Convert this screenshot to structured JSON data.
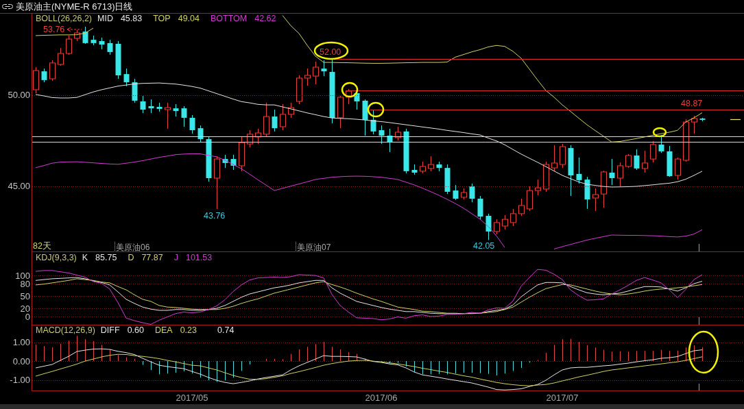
{
  "window": {
    "title": "美原油主(NYME-R 6713)日线"
  },
  "price_panel": {
    "chart_data": {
      "type": "candlestick",
      "ylim": [
        41.39,
        54.51
      ],
      "ohlc": [
        [
          50.3,
          51.54,
          50.11,
          51.35
        ],
        [
          51.31,
          51.46,
          50.71,
          50.83
        ],
        [
          50.9,
          51.92,
          50.79,
          51.77
        ],
        [
          51.69,
          52.59,
          51.62,
          52.29
        ],
        [
          52.29,
          53.27,
          52.22,
          53.08
        ],
        [
          53.12,
          53.57,
          52.97,
          53.42
        ],
        [
          53.49,
          53.76,
          52.82,
          52.86
        ],
        [
          53.04,
          53.27,
          52.74,
          52.86
        ],
        [
          52.97,
          53.16,
          52.52,
          52.78
        ],
        [
          52.86,
          53.04,
          52.22,
          52.37
        ],
        [
          52.82,
          52.97,
          50.9,
          51.09
        ],
        [
          51.16,
          51.46,
          50.49,
          50.71
        ],
        [
          50.71,
          50.9,
          49.59,
          49.7
        ],
        [
          49.66,
          49.96,
          49.02,
          49.21
        ],
        [
          49.4,
          49.77,
          49.02,
          49.28
        ],
        [
          49.36,
          49.59,
          49.1,
          49.25
        ],
        [
          49.21,
          49.59,
          48.16,
          49.32
        ],
        [
          49.28,
          49.51,
          48.83,
          49.13
        ],
        [
          49.28,
          49.4,
          48.27,
          48.76
        ],
        [
          48.76,
          48.91,
          47.89,
          48.08
        ],
        [
          48.19,
          48.34,
          47.4,
          47.59
        ],
        [
          47.59,
          47.71,
          45.26,
          45.45
        ],
        [
          45.45,
          46.65,
          43.76,
          46.5
        ],
        [
          46.5,
          46.73,
          46.01,
          46.28
        ],
        [
          46.5,
          46.73,
          45.9,
          46.13
        ],
        [
          46.13,
          47.71,
          45.83,
          47.4
        ],
        [
          47.33,
          48.08,
          47.14,
          47.86
        ],
        [
          47.71,
          48.16,
          47.33,
          47.93
        ],
        [
          47.86,
          49.59,
          47.71,
          48.83
        ],
        [
          48.83,
          49.21,
          48.01,
          48.19
        ],
        [
          48.27,
          49.51,
          48.08,
          48.95
        ],
        [
          48.95,
          49.59,
          48.76,
          49.32
        ],
        [
          49.66,
          51.09,
          49.51,
          50.94
        ],
        [
          50.94,
          51.46,
          50.52,
          51.09
        ],
        [
          51.05,
          51.84,
          50.6,
          51.54
        ],
        [
          51.46,
          51.92,
          51.05,
          51.31
        ],
        [
          51.28,
          52.0,
          48.46,
          48.76
        ],
        [
          48.76,
          49.96,
          48.19,
          49.89
        ],
        [
          49.89,
          50.34,
          49.51,
          50.22
        ],
        [
          50.11,
          50.22,
          49.21,
          49.66
        ],
        [
          49.7,
          49.77,
          47.78,
          48.65
        ],
        [
          48.65,
          49.21,
          47.86,
          48.01
        ],
        [
          48.08,
          48.34,
          47.33,
          47.78
        ],
        [
          47.78,
          48.16,
          46.88,
          47.44
        ],
        [
          47.67,
          48.27,
          47.52,
          47.97
        ],
        [
          48.01,
          48.16,
          45.71,
          45.83
        ],
        [
          45.9,
          46.2,
          45.64,
          45.75
        ],
        [
          45.83,
          46.35,
          45.71,
          46.09
        ],
        [
          45.98,
          46.65,
          45.83,
          46.2
        ],
        [
          46.2,
          46.35,
          45.83,
          46.01
        ],
        [
          46.01,
          46.2,
          44.58,
          44.7
        ],
        [
          44.77,
          45.07,
          44.25,
          44.32
        ],
        [
          44.4,
          44.89,
          44.28,
          44.66
        ],
        [
          45.0,
          45.15,
          44.13,
          44.32
        ],
        [
          44.32,
          44.47,
          43.19,
          43.34
        ],
        [
          43.38,
          43.5,
          42.05,
          42.52
        ],
        [
          42.52,
          43.19,
          42.37,
          43.01
        ],
        [
          42.82,
          43.42,
          42.63,
          43.19
        ],
        [
          43.01,
          43.76,
          42.82,
          43.5
        ],
        [
          43.5,
          44.32,
          43.38,
          43.95
        ],
        [
          43.76,
          45.0,
          43.65,
          44.77
        ],
        [
          44.77,
          45.37,
          44.51,
          44.92
        ],
        [
          44.85,
          46.35,
          44.7,
          46.2
        ],
        [
          46.01,
          47.25,
          45.83,
          46.28
        ],
        [
          46.2,
          47.33,
          46.01,
          47.18
        ],
        [
          47.1,
          47.25,
          44.47,
          45.6
        ],
        [
          45.68,
          46.58,
          45.15,
          45.34
        ],
        [
          45.37,
          45.52,
          43.76,
          44.28
        ],
        [
          44.36,
          44.89,
          43.65,
          44.55
        ],
        [
          44.58,
          45.86,
          43.83,
          45.79
        ],
        [
          45.75,
          46.5,
          45.07,
          45.45
        ],
        [
          45.45,
          46.31,
          45.0,
          46.13
        ],
        [
          46.09,
          46.77,
          46.01,
          46.69
        ],
        [
          46.69,
          47.03,
          45.9,
          45.98
        ],
        [
          45.98,
          46.95,
          45.75,
          46.28
        ],
        [
          46.5,
          47.48,
          46.31,
          47.29
        ],
        [
          47.29,
          47.82,
          46.84,
          46.92
        ],
        [
          46.92,
          47.22,
          45.52,
          45.56
        ],
        [
          45.6,
          46.58,
          45.37,
          46.5
        ],
        [
          46.43,
          48.68,
          46.35,
          48.53
        ],
        [
          48.53,
          48.87,
          47.89,
          48.72
        ],
        [
          48.72,
          48.76,
          48.57,
          48.65
        ]
      ]
    },
    "bollinger": {
      "readings": [
        "45.83",
        "49.04",
        "42.62"
      ],
      "chart_data": {
        "type": "line",
        "title": "BOLL(26,26,2)",
        "ylim": [
          41.39,
          54.51
        ],
        "yticks": [
          {
            "value": 50,
            "label": "50.00"
          },
          {
            "value": 45,
            "label": "45.00"
          }
        ],
        "grid": true,
        "series": [
          {
            "name": "MID",
            "color": "#e6e6e6",
            "values": [
              50.04,
              49.96,
              49.87,
              49.85,
              49.85,
              49.88,
              50.03,
              50.18,
              50.3,
              50.4,
              50.5,
              50.56,
              50.62,
              50.65,
              50.66,
              50.67,
              50.64,
              50.61,
              50.55,
              50.48,
              50.39,
              50.24,
              50.09,
              49.94,
              49.79,
              49.65,
              49.58,
              49.5,
              49.47,
              49.47,
              49.36,
              49.25,
              49.14,
              49.03,
              48.93,
              48.83,
              48.75,
              48.73,
              48.71,
              48.68,
              48.64,
              48.59,
              48.55,
              48.5,
              48.44,
              48.38,
              48.32,
              48.26,
              48.2,
              48.14,
              48.07,
              48.01,
              47.95,
              47.88,
              47.82,
              47.65,
              47.49,
              47.28,
              47.02,
              46.77,
              46.54,
              46.32,
              46.08,
              45.84,
              45.6,
              45.42,
              45.24,
              45.11,
              45.05,
              44.99,
              44.96,
              44.97,
              44.98,
              45.0,
              45.04,
              45.08,
              45.13,
              45.17,
              45.25,
              45.39,
              45.6,
              45.83
            ]
          },
          {
            "name": "TOP",
            "color": "#d2d264",
            "values": [
              53.27,
              53.29,
              53.3,
              53.31,
              53.31,
              53.32,
              53.41,
              53.68,
              null,
              null,
              null,
              null,
              null,
              null,
              null,
              null,
              null,
              null,
              null,
              null,
              null,
              null,
              null,
              null,
              null,
              null,
              null,
              null,
              null,
              null,
              54.38,
              53.82,
              53.39,
              52.74,
              52.14,
              51.8,
              51.8,
              51.79,
              51.78,
              51.77,
              51.76,
              51.75,
              51.75,
              51.76,
              51.77,
              51.78,
              51.79,
              51.8,
              51.8,
              51.8,
              51.82,
              52.09,
              52.23,
              52.38,
              52.5,
              52.65,
              52.73,
              52.68,
              52.41,
              52.03,
              51.43,
              50.83,
              50.26,
              49.89,
              49.47,
              49.11,
              48.74,
              48.38,
              48.06,
              47.75,
              47.43,
              47.46,
              47.54,
              47.62,
              47.71,
              47.8,
              47.89,
              47.97,
              48.07,
              48.53,
              48.76,
              49.04
            ]
          },
          {
            "name": "BOTTOM",
            "color": "#d23cd2",
            "values": [
              46.02,
              46.14,
              46.27,
              46.33,
              46.34,
              46.35,
              46.32,
              46.29,
              46.26,
              46.23,
              46.21,
              46.27,
              46.33,
              46.41,
              46.5,
              46.59,
              46.66,
              46.74,
              46.77,
              46.79,
              46.78,
              46.7,
              46.62,
              46.43,
              46.2,
              45.97,
              45.67,
              45.36,
              45.07,
              44.77,
              44.89,
              45.01,
              45.13,
              45.25,
              45.38,
              45.44,
              45.5,
              45.53,
              45.55,
              45.56,
              45.55,
              45.53,
              45.5,
              45.44,
              45.38,
              45.23,
              45.08,
              44.9,
              44.71,
              44.51,
              44.29,
              44.06,
              43.8,
              43.5,
              43.2,
              42.8,
              42.28,
              41.65,
              null,
              null,
              null,
              null,
              null,
              41.56,
              41.69,
              41.81,
              41.93,
              42.05,
              42.15,
              42.24,
              42.33,
              42.32,
              42.31,
              42.31,
              42.3,
              42.29,
              42.27,
              42.24,
              42.22,
              42.27,
              42.38,
              42.62
            ]
          }
        ]
      }
    },
    "price_labels": [
      {
        "text": "53.76",
        "kind": "high",
        "arrow": true
      },
      {
        "text": "52.00",
        "kind": "high",
        "arrow": false
      },
      {
        "text": "48.87",
        "kind": "high",
        "arrow": false
      },
      {
        "text": "43.76",
        "kind": "low",
        "arrow": false
      },
      {
        "text": "42.05",
        "kind": "low",
        "arrow": false
      }
    ],
    "day_count": "82天",
    "contract_markers": [
      "美原油06",
      "美原油07"
    ]
  },
  "kdj_panel": {
    "readings": [
      "85.75",
      "77.87",
      "101.53"
    ],
    "chart_data": {
      "type": "line",
      "title": "KDJ(9,3,3)",
      "ylim": [
        -20,
        157
      ],
      "yticks": [
        100,
        80,
        50,
        20,
        0
      ],
      "grid": true,
      "series": [
        {
          "name": "K",
          "color": "#e6e6e6",
          "values": [
            88,
            90,
            92,
            93,
            94,
            95,
            92,
            87,
            83,
            77,
            60,
            42,
            32,
            23,
            18,
            15,
            15,
            17,
            17,
            15,
            15,
            17,
            20,
            27,
            37,
            47,
            55,
            60,
            65,
            70,
            73,
            77,
            82,
            85,
            88,
            88,
            70,
            57,
            47,
            37,
            32,
            27,
            22,
            18,
            15,
            12,
            12,
            10,
            8,
            7,
            7,
            7,
            7,
            8,
            8,
            12,
            15,
            18,
            28,
            48,
            63,
            77,
            83,
            83,
            82,
            73,
            65,
            58,
            55,
            53,
            55,
            57,
            62,
            68,
            73,
            73,
            72,
            67,
            62,
            70,
            80,
            86
          ]
        },
        {
          "name": "D",
          "color": "#d2d264",
          "values": [
            77,
            79,
            82,
            85,
            88,
            92,
            90,
            88,
            84,
            82,
            73,
            65,
            53,
            42,
            37,
            27,
            23,
            22,
            20,
            18,
            17,
            17,
            17,
            20,
            25,
            32,
            38,
            43,
            50,
            57,
            62,
            67,
            72,
            77,
            82,
            85,
            78,
            72,
            65,
            57,
            50,
            43,
            37,
            30,
            23,
            20,
            17,
            13,
            12,
            10,
            8,
            8,
            7,
            7,
            8,
            10,
            12,
            17,
            23,
            35,
            47,
            58,
            68,
            73,
            78,
            77,
            72,
            67,
            62,
            58,
            55,
            53,
            55,
            58,
            62,
            65,
            67,
            68,
            70,
            72,
            75,
            78
          ]
        },
        {
          "name": "J",
          "color": "#d23cd2",
          "values": [
            110,
            112,
            112,
            109,
            106,
            101,
            96,
            85,
            81,
            67,
            34,
            -4,
            -10,
            -15,
            -20,
            -9,
            -1,
            7,
            11,
            9,
            11,
            17,
            26,
            41,
            61,
            77,
            89,
            94,
            95,
            96,
            95,
            97,
            102,
            101,
            100,
            94,
            54,
            27,
            11,
            -3,
            -4,
            -5,
            -8,
            -6,
            -1,
            -4,
            2,
            4,
            0,
            1,
            5,
            5,
            7,
            10,
            8,
            16,
            21,
            20,
            38,
            74,
            95,
            115,
            113,
            103,
            90,
            65,
            51,
            40,
            41,
            43,
            55,
            65,
            76,
            88,
            95,
            89,
            82,
            65,
            46,
            66,
            90,
            102
          ]
        }
      ]
    }
  },
  "macd_panel": {
    "readings": [
      "0.60",
      "0.23",
      "0.74"
    ],
    "chart_data": {
      "type": "line",
      "title": "MACD(12,26,9)",
      "ylim": [
        -1.56,
        1.93
      ],
      "yticks": [
        {
          "value": 1,
          "label": "1.00"
        },
        {
          "value": 0,
          "label": "0.00"
        },
        {
          "value": -1,
          "label": "-1.00"
        }
      ],
      "grid": true,
      "series": [
        {
          "name": "DIFF",
          "color": "#e6e6e6",
          "values": [
            -0.36,
            -0.27,
            -0.18,
            0.04,
            0.25,
            0.51,
            0.58,
            0.64,
            0.65,
            0.62,
            0.52,
            0.45,
            0.35,
            0.15,
            -0.04,
            -0.22,
            -0.29,
            -0.35,
            -0.4,
            -0.55,
            -0.69,
            -0.87,
            -1.02,
            -1.13,
            -1.2,
            -1.13,
            -1.05,
            -0.95,
            -0.87,
            -0.8,
            -0.73,
            -0.47,
            -0.25,
            -0.07,
            0.11,
            0.29,
            0.25,
            0.25,
            0.24,
            0.22,
            0.11,
            -0.02,
            -0.07,
            -0.15,
            -0.2,
            -0.36,
            -0.58,
            -0.73,
            -0.8,
            -0.87,
            -0.95,
            -1.02,
            -1.09,
            -1.16,
            -1.27,
            -1.38,
            -1.51,
            -1.53,
            -1.51,
            -1.47,
            -1.35,
            -1.24,
            -1.02,
            -0.73,
            -0.47,
            -0.36,
            -0.33,
            -0.33,
            -0.29,
            -0.25,
            -0.22,
            -0.16,
            -0.11,
            -0.04,
            0.02,
            0.07,
            0.15,
            0.18,
            0.24,
            0.4,
            0.55,
            0.6
          ]
        },
        {
          "name": "DEA",
          "color": "#d2d264",
          "values": [
            -0.8,
            -0.67,
            -0.55,
            -0.42,
            -0.29,
            -0.16,
            0,
            0.11,
            0.22,
            0.31,
            0.36,
            0.35,
            0.29,
            0.25,
            0.2,
            0.13,
            0.04,
            -0.04,
            -0.13,
            -0.22,
            -0.25,
            -0.36,
            -0.47,
            -0.62,
            -0.76,
            -0.87,
            -0.96,
            -0.97,
            -0.93,
            -0.86,
            -0.78,
            -0.66,
            -0.56,
            -0.45,
            -0.34,
            -0.22,
            -0.13,
            -0.06,
            0,
            0.03,
            0.04,
            0,
            -0.04,
            -0.09,
            -0.15,
            -0.22,
            -0.29,
            -0.38,
            -0.45,
            -0.53,
            -0.6,
            -0.69,
            -0.78,
            -0.85,
            -0.95,
            -1.04,
            -1.13,
            -1.2,
            -1.25,
            -1.29,
            -1.31,
            -1.27,
            -1.24,
            -1.16,
            -1.05,
            -0.95,
            -0.84,
            -0.75,
            -0.65,
            -0.55,
            -0.47,
            -0.42,
            -0.36,
            -0.31,
            -0.25,
            -0.2,
            -0.15,
            -0.09,
            -0.04,
            0.04,
            0.13,
            0.23
          ]
        }
      ]
    },
    "date_labels": [
      "2017/05",
      "2017/06",
      "2017/07"
    ]
  }
}
